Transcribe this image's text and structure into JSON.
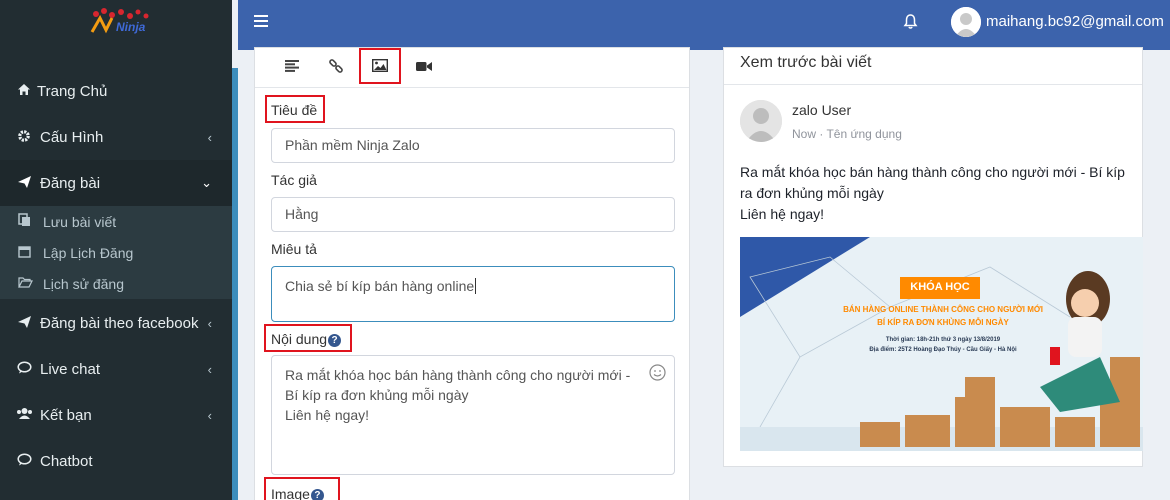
{
  "header": {
    "user_email": "maihang.bc92@gmail.com",
    "bell_icon": "bell-icon",
    "menu_icon": "hamburger-icon"
  },
  "logo": {
    "text": "Ninja"
  },
  "sidebar": {
    "items": [
      {
        "label": "Trang Chủ",
        "icon": "home-icon"
      },
      {
        "label": "Cấu Hình",
        "icon": "gear-icon"
      },
      {
        "label": "Đăng bài",
        "icon": "paper-plane-icon"
      },
      {
        "label": "Đăng bài theo facebook",
        "icon": "paper-plane-icon"
      },
      {
        "label": "Live chat",
        "icon": "chat-bubble-icon"
      },
      {
        "label": "Kết bạn",
        "icon": "users-icon"
      },
      {
        "label": "Chatbot",
        "icon": "chat-bubble-icon"
      }
    ],
    "sub_items": [
      {
        "label": "Lưu bài viết",
        "icon": "copy-icon"
      },
      {
        "label": "Lập Lịch Đăng",
        "icon": "calendar-icon"
      },
      {
        "label": "Lịch sử đăng",
        "icon": "folder-open-icon"
      }
    ]
  },
  "editor": {
    "tabs": [
      {
        "icon": "align-left-icon"
      },
      {
        "icon": "link-icon"
      },
      {
        "icon": "image-icon"
      },
      {
        "icon": "video-camera-icon"
      }
    ],
    "title_label": "Tiêu đề",
    "title_value": "Phần mềm Ninja Zalo",
    "author_label": "Tác giả",
    "author_value": "Hằng",
    "description_label": "Miêu tả",
    "description_value": "Chia sẻ bí kíp bán hàng online",
    "content_label": "Nội dung",
    "content_lines": [
      "Ra mắt khóa học bán hàng thành công cho người mới -",
      "Bí kíp ra đơn khủng mỗi ngày",
      "Liên hệ ngay!"
    ],
    "image_label": "Image",
    "help_glyph": "?"
  },
  "preview": {
    "title": "Xem trước bài viết",
    "user_name": "zalo User",
    "meta": "Now · Tên ứng dụng",
    "body_lines": [
      "Ra mắt khóa học bán hàng thành công cho người mới - Bí kíp",
      "ra đơn khủng mỗi ngày",
      "Liên hệ ngay!"
    ],
    "banner": {
      "heading": "KHÓA HỌC",
      "line1": "BÁN HÀNG ONLINE THÀNH CÔNG CHO NGƯỜI MỚI",
      "line2": "BÍ KÍP RA ĐƠN KHỦNG MỖI NGÀY",
      "time": "Thời gian: 18h-21h thứ 3 ngày 13/8/2019",
      "place": "Địa điểm: 25T2 Hoàng Đạo Thúy - Cầu Giấy - Hà Nội"
    }
  },
  "colors": {
    "topbar": "#3c63ac",
    "sidebar": "#222d32",
    "highlight": "#e0141e",
    "banner_accent": "#ff8a00"
  }
}
